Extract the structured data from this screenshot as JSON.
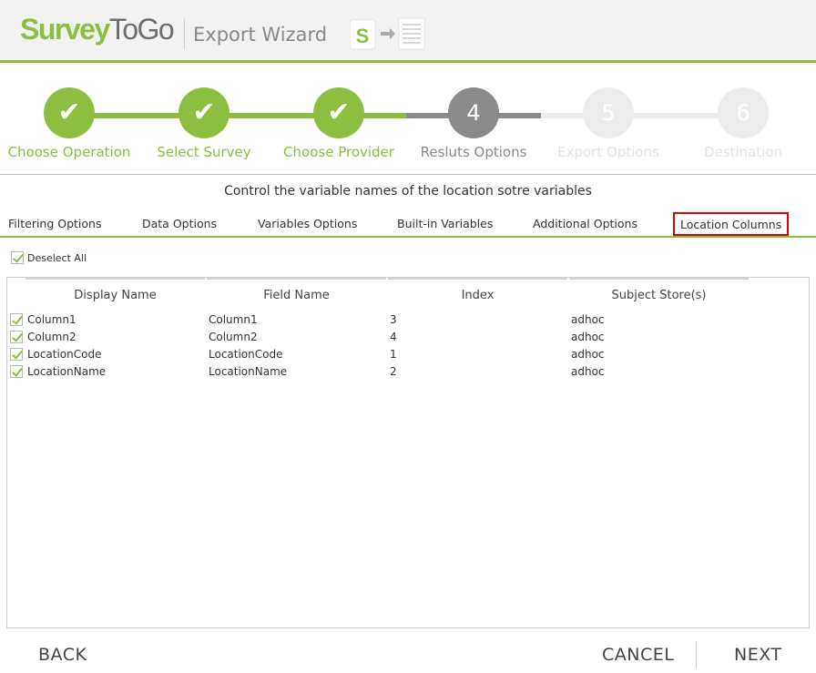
{
  "header": {
    "logo_part1": "Survey",
    "logo_part2": "ToGo",
    "title": "Export Wizard",
    "icon": "export-s-to-document-icon"
  },
  "steps": [
    {
      "number": "1",
      "label": "Choose Operation",
      "state": "done"
    },
    {
      "number": "2",
      "label": "Select Survey",
      "state": "done"
    },
    {
      "number": "3",
      "label": "Choose Provider",
      "state": "done"
    },
    {
      "number": "4",
      "label": "Resluts Options",
      "state": "current"
    },
    {
      "number": "5",
      "label": "Export Options",
      "state": "future"
    },
    {
      "number": "6",
      "label": "Destination",
      "state": "future"
    }
  ],
  "subtitle": "Control the variable names of the location sotre variables",
  "tabs": [
    {
      "label": "Filtering Options"
    },
    {
      "label": "Data Options"
    },
    {
      "label": "Variables Options"
    },
    {
      "label": "Built-in Variables"
    },
    {
      "label": "Additional Options"
    },
    {
      "label": "Location Columns",
      "active": true
    }
  ],
  "deselect_all": {
    "label": "Deselect All",
    "checked": true
  },
  "table": {
    "columns": [
      "Display Name",
      "Field Name",
      "Index",
      "Subject Store(s)"
    ],
    "rows": [
      {
        "checked": true,
        "display_name": "Column1",
        "field_name": "Column1",
        "index": "3",
        "subject_store": "adhoc"
      },
      {
        "checked": true,
        "display_name": "Column2",
        "field_name": "Column2",
        "index": "4",
        "subject_store": "adhoc"
      },
      {
        "checked": true,
        "display_name": "LocationCode",
        "field_name": "LocationCode",
        "index": "1",
        "subject_store": "adhoc"
      },
      {
        "checked": true,
        "display_name": "LocationName",
        "field_name": "LocationName",
        "index": "2",
        "subject_store": "adhoc"
      }
    ]
  },
  "footer": {
    "back": "BACK",
    "cancel": "CANCEL",
    "next": "NEXT"
  },
  "colors": {
    "accent": "#8cbf3f",
    "current_step": "#8a8a8a",
    "future_step": "#ececec",
    "highlight_border": "#e00000"
  }
}
